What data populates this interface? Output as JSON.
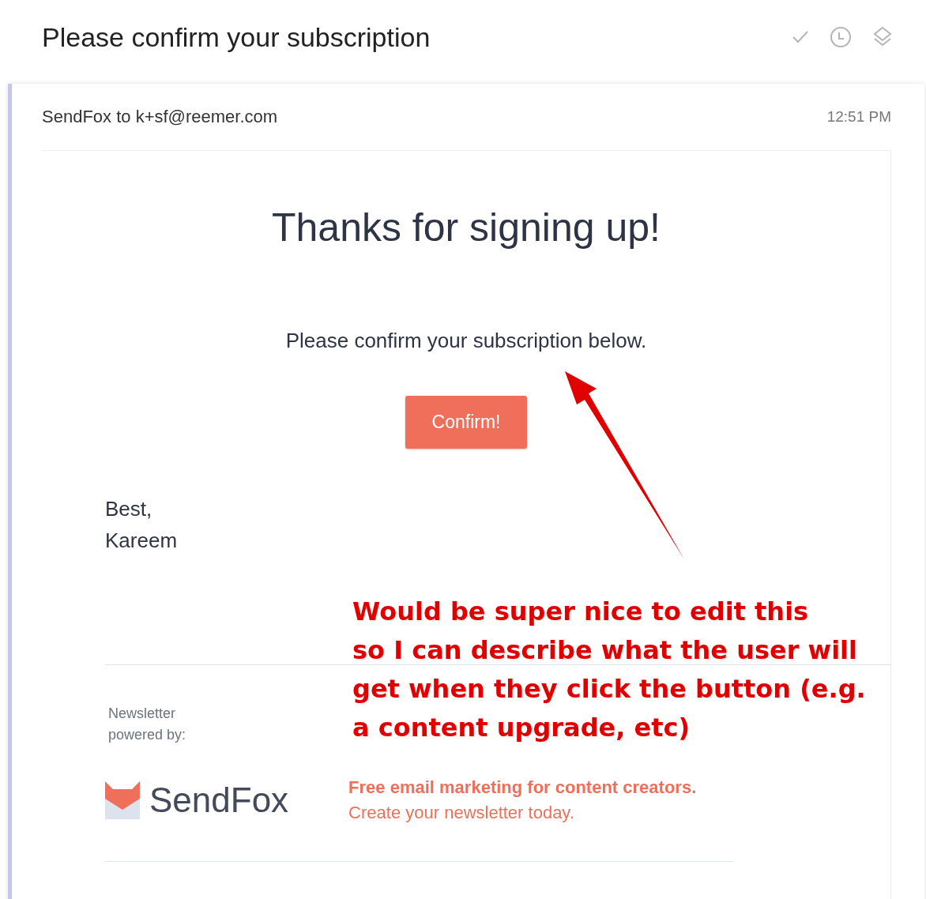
{
  "header": {
    "title": "Please confirm your subscription",
    "actions": [
      {
        "kind": "done"
      },
      {
        "kind": "snooze"
      },
      {
        "kind": "move"
      }
    ]
  },
  "message": {
    "sender_line": "SendFox to k+sf@reemer.com",
    "time": "12:51 PM",
    "body": {
      "heading": "Thanks for signing up!",
      "text": "Please confirm your subscription below.",
      "button": "Confirm!",
      "signoff": [
        "Best,",
        "Kareem"
      ],
      "footer": {
        "powered_by": [
          "Newsletter",
          "powered by:"
        ],
        "brand": "SendFox",
        "tagline": "Free email marketing for content creators.",
        "cta": "Create your newsletter today."
      }
    }
  },
  "annotation": {
    "lines": [
      "Would be super nice to edit this",
      "so I can describe what the user will",
      "get when they click the button (e.g.",
      "a content upgrade, etc)"
    ]
  }
}
